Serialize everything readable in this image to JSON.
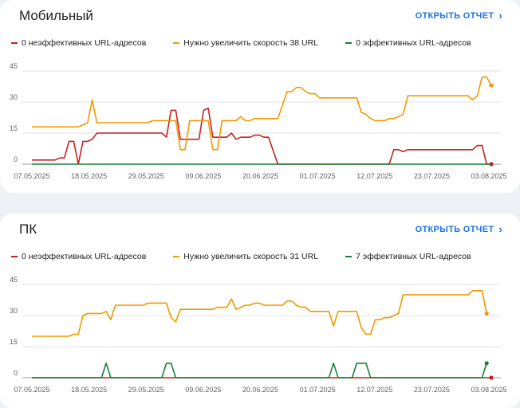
{
  "colors": {
    "red": "#c5221f",
    "orange": "#f29900",
    "green": "#188038",
    "grid": "#e0e0e0",
    "link": "#1a73e8"
  },
  "report_link_label": "ОТКРЫТЬ ОТЧЕТ",
  "report_link_icon": "›",
  "chart_data": [
    {
      "type": "line",
      "title": "Мобильный",
      "ylim": [
        0,
        45
      ],
      "yticks": [
        0,
        15,
        30,
        45
      ],
      "x_tick_labels": [
        "07.05.2025",
        "18.05.2025",
        "29.05.2025",
        "09.06.2025",
        "20.06.2025",
        "01.07.2025",
        "12.07.2025",
        "23.07.2025",
        "03.08.2025"
      ],
      "x_start": "07.05.2025",
      "x_end": "04.08.2025",
      "legend": [
        "0 неэффективных URL-адресов",
        "Нужно увеличить скорость 38 URL",
        "0 эффективных URL-адресов"
      ],
      "series": [
        {
          "name": "0 неэффективных URL-адресов",
          "color_key": "red",
          "points": [
            [
              0,
              2
            ],
            [
              5,
              2
            ],
            [
              6,
              3
            ],
            [
              7,
              3
            ],
            [
              8,
              11
            ],
            [
              9,
              11
            ],
            [
              10,
              0
            ],
            [
              11,
              11
            ],
            [
              12,
              11
            ],
            [
              13,
              12
            ],
            [
              14,
              15
            ],
            [
              28,
              15
            ],
            [
              29,
              13
            ],
            [
              30,
              26
            ],
            [
              31,
              26
            ],
            [
              32,
              12
            ],
            [
              36,
              12
            ],
            [
              37,
              26
            ],
            [
              38,
              27
            ],
            [
              39,
              13
            ],
            [
              42,
              13
            ],
            [
              43,
              15
            ],
            [
              44,
              12
            ],
            [
              45,
              13
            ],
            [
              47,
              13
            ],
            [
              48,
              14
            ],
            [
              49,
              14
            ],
            [
              50,
              13
            ],
            [
              51,
              13
            ],
            [
              53,
              0
            ],
            [
              77,
              0
            ],
            [
              78,
              7
            ],
            [
              79,
              7
            ],
            [
              80,
              6
            ],
            [
              81,
              7
            ],
            [
              95,
              7
            ],
            [
              96,
              9
            ],
            [
              97,
              9
            ],
            [
              98,
              0
            ],
            [
              99,
              0
            ]
          ],
          "end_marker": true
        },
        {
          "name": "Нужно увеличить скорость 38 URL",
          "color_key": "orange",
          "points": [
            [
              0,
              18
            ],
            [
              10,
              18
            ],
            [
              11,
              19
            ],
            [
              12,
              20
            ],
            [
              13,
              31
            ],
            [
              14,
              20
            ],
            [
              25,
              20
            ],
            [
              26,
              21
            ],
            [
              31,
              21
            ],
            [
              32,
              7
            ],
            [
              33,
              7
            ],
            [
              34,
              21
            ],
            [
              38,
              21
            ],
            [
              39,
              7
            ],
            [
              40,
              7
            ],
            [
              41,
              21
            ],
            [
              44,
              21
            ],
            [
              45,
              23
            ],
            [
              46,
              21
            ],
            [
              47,
              21
            ],
            [
              48,
              22
            ],
            [
              53,
              22
            ],
            [
              55,
              35
            ],
            [
              56,
              35
            ],
            [
              57,
              37
            ],
            [
              58,
              37
            ],
            [
              59,
              35
            ],
            [
              60,
              34
            ],
            [
              61,
              34
            ],
            [
              62,
              32
            ],
            [
              70,
              32
            ],
            [
              71,
              25
            ],
            [
              72,
              24
            ],
            [
              73,
              22
            ],
            [
              74,
              21
            ],
            [
              76,
              21
            ],
            [
              77,
              22
            ],
            [
              78,
              22
            ],
            [
              79,
              23
            ],
            [
              80,
              24
            ],
            [
              81,
              33
            ],
            [
              94,
              33
            ],
            [
              95,
              31
            ],
            [
              96,
              33
            ],
            [
              97,
              42
            ],
            [
              98,
              42
            ],
            [
              99,
              38
            ]
          ],
          "end_marker": true
        },
        {
          "name": "0 эффективных URL-адресов",
          "color_key": "green",
          "points": [
            [
              0,
              0
            ],
            [
              99,
              0
            ]
          ],
          "end_marker": false
        }
      ]
    },
    {
      "type": "line",
      "title": "ПК",
      "ylim": [
        0,
        45
      ],
      "yticks": [
        0,
        15,
        30,
        45
      ],
      "x_tick_labels": [
        "07.05.2025",
        "18.05.2025",
        "29.05.2025",
        "09.06.2025",
        "20.06.2025",
        "01.07.2025",
        "12.07.2025",
        "23.07.2025",
        "03.08.2025"
      ],
      "x_start": "07.05.2025",
      "x_end": "04.08.2025",
      "legend": [
        "0 неэффективных URL-адресов",
        "Нужно увеличить скорость 31 URL",
        "7 эффективных URL-адресов"
      ],
      "series": [
        {
          "name": "0 неэффективных URL-адресов",
          "color_key": "red",
          "points": [
            [
              0,
              0
            ],
            [
              99,
              0
            ]
          ],
          "end_marker": true
        },
        {
          "name": "Нужно увеличить скорость 31 URL",
          "color_key": "orange",
          "points": [
            [
              0,
              20
            ],
            [
              8,
              20
            ],
            [
              9,
              21
            ],
            [
              10,
              21
            ],
            [
              11,
              30
            ],
            [
              12,
              31
            ],
            [
              15,
              31
            ],
            [
              16,
              32
            ],
            [
              17,
              28
            ],
            [
              18,
              35
            ],
            [
              24,
              35
            ],
            [
              25,
              36
            ],
            [
              29,
              36
            ],
            [
              30,
              29
            ],
            [
              31,
              27
            ],
            [
              32,
              33
            ],
            [
              39,
              33
            ],
            [
              40,
              34
            ],
            [
              42,
              34
            ],
            [
              43,
              38
            ],
            [
              44,
              33
            ],
            [
              45,
              34
            ],
            [
              46,
              35
            ],
            [
              47,
              35
            ],
            [
              48,
              36
            ],
            [
              49,
              36
            ],
            [
              50,
              35
            ],
            [
              54,
              35
            ],
            [
              55,
              37
            ],
            [
              56,
              37
            ],
            [
              57,
              35
            ],
            [
              58,
              34
            ],
            [
              59,
              34
            ],
            [
              60,
              32
            ],
            [
              64,
              32
            ],
            [
              65,
              25
            ],
            [
              66,
              32
            ],
            [
              70,
              32
            ],
            [
              71,
              24
            ],
            [
              72,
              21
            ],
            [
              73,
              21
            ],
            [
              74,
              28
            ],
            [
              75,
              28
            ],
            [
              76,
              29
            ],
            [
              77,
              29
            ],
            [
              78,
              30
            ],
            [
              79,
              31
            ],
            [
              80,
              40
            ],
            [
              94,
              40
            ],
            [
              95,
              42
            ],
            [
              97,
              42
            ],
            [
              98,
              31
            ]
          ],
          "end_marker": true
        },
        {
          "name": "7 эффективных URL-адресов",
          "color_key": "green",
          "points": [
            [
              0,
              0
            ],
            [
              15,
              0
            ],
            [
              16,
              7
            ],
            [
              17,
              0
            ],
            [
              28,
              0
            ],
            [
              29,
              7
            ],
            [
              30,
              7
            ],
            [
              31,
              0
            ],
            [
              64,
              0
            ],
            [
              65,
              7
            ],
            [
              66,
              0
            ],
            [
              69,
              0
            ],
            [
              70,
              7
            ],
            [
              72,
              7
            ],
            [
              73,
              0
            ],
            [
              97,
              0
            ],
            [
              98,
              7
            ]
          ],
          "end_marker": true
        }
      ]
    }
  ]
}
